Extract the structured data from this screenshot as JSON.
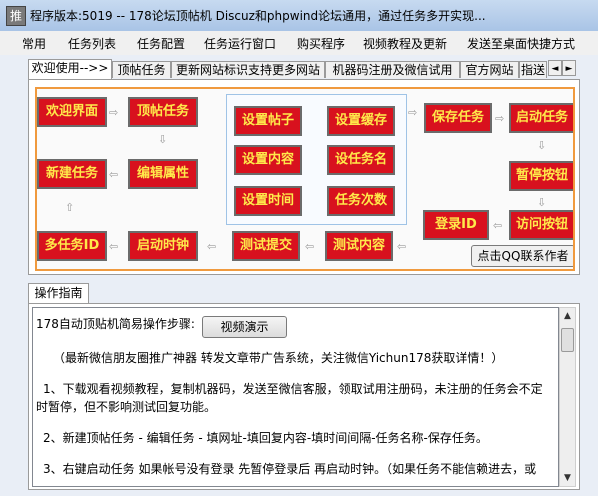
{
  "window": {
    "icon_char": "推",
    "title": "程序版本:5019 -- 178论坛顶帖机 Discuz和phpwind论坛通用，通过任务多开实现..."
  },
  "menu": [
    "常用",
    "任务列表",
    "任务配置",
    "任务运行窗口",
    "购买程序",
    "视频教程及更新",
    "发送至桌面快捷方式"
  ],
  "top_tabs": {
    "items": [
      "欢迎使用-->>",
      "顶帖任务",
      "更新网站标识支持更多网站",
      "机器码注册及微信试用",
      "官方网站",
      "指送"
    ],
    "scroll_left": "◄",
    "scroll_right": "►"
  },
  "flow": {
    "boxes": {
      "welcome": "欢迎界面",
      "top_task": "顶帖任务",
      "new_task": "新建任务",
      "edit_attr": "编辑属性",
      "multi_id": "多任务ID",
      "start_clock": "启动时钟",
      "test_submit": "测试提交",
      "test_content": "测试内容",
      "set_post": "设置帖子",
      "set_cache": "设置缓存",
      "set_content": "设置内容",
      "set_taskname": "设任务名",
      "set_time": "设置时间",
      "task_count": "任务次数",
      "save_task": "保存任务",
      "start_task": "启动任务",
      "pause_btn": "暂停按钮",
      "visit_btn": "访问按钮",
      "login_id": "登录ID"
    },
    "qq_button": "点击QQ联系作者"
  },
  "guide_tab": "操作指南",
  "guide": {
    "heading": "178自动顶贴机简易操作步骤:",
    "demo_button": "视频演示",
    "lines": [
      "（最新微信朋友圈推广神器 转发文章带广告系统，关注微信Yichun178获取详情！）",
      "1、下载观看视频教程，复制机器码，发送至微信客服，领取试用注册码，未注册的任务会不定",
      "时暂停，但不影响测试回复功能。",
      "2、新建顶帖任务 - 编辑任务 - 填网址-填回复内容-填时间间隔-任务名称-保存任务。",
      "3、右键启动任务 如果帐号没有登录 先暂停登录后 再启动时钟。（如果任务不能信赖进去，或"
    ]
  },
  "scrollbar": {
    "up": "▲",
    "down": "▼"
  }
}
